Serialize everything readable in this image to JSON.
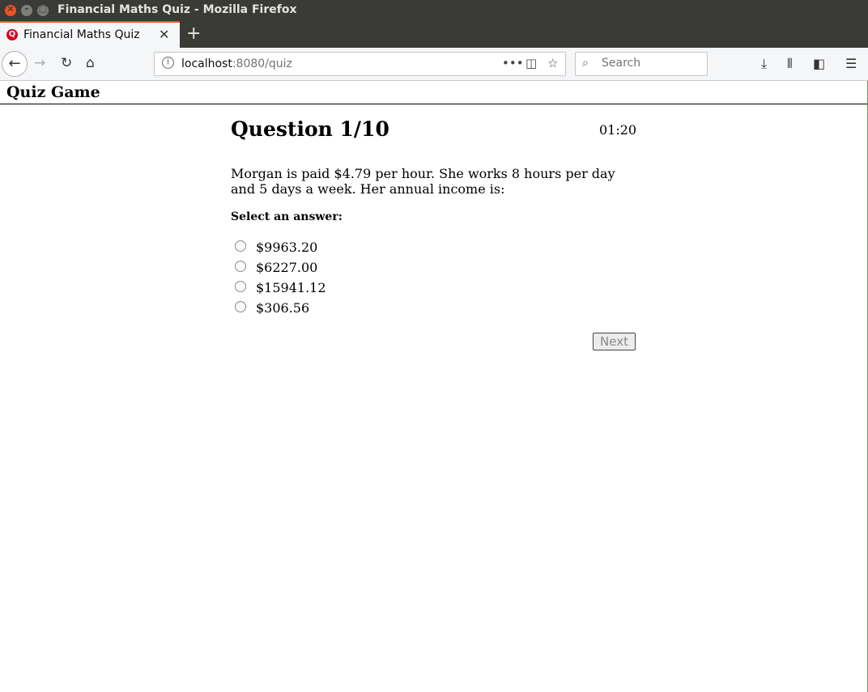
{
  "window": {
    "title": "Financial Maths Quiz - Mozilla Firefox"
  },
  "tab": {
    "favicon": "Q",
    "label": "Financial Maths Quiz"
  },
  "navbar": {
    "url_host": "localhost",
    "url_rest": ":8080/quiz",
    "search_placeholder": "Search"
  },
  "app": {
    "title": "Quiz Game"
  },
  "quiz": {
    "question_title": "Question 1/10",
    "timer": "01:20",
    "question_text": "Morgan is paid $4.79 per hour. She works 8 hours per day and 5 days a week. Her annual income is:",
    "prompt": "Select an answer:",
    "options": [
      "$9963.20",
      "$6227.00",
      "$15941.12",
      "$306.56"
    ],
    "next_label": "Next"
  },
  "colors": {
    "accent": "#e95420",
    "titlebar": "#3a3a37"
  }
}
